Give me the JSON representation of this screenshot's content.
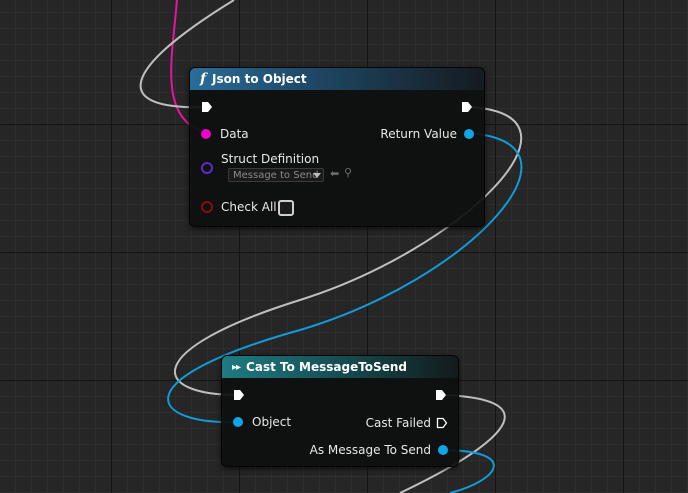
{
  "graph": {
    "nodes": {
      "json_to_object": {
        "title": "Json to Object",
        "icon": "function-icon",
        "inputs": {
          "data_label": "Data",
          "struct_definition_label": "Struct Definition",
          "struct_definition_value": "Message to Send",
          "check_all_label": "Check All"
        },
        "outputs": {
          "return_value_label": "Return Value"
        }
      },
      "cast_to_message": {
        "title": "Cast To MessageToSend",
        "icon": "cast-icon",
        "inputs": {
          "object_label": "Object"
        },
        "outputs": {
          "cast_failed_label": "Cast Failed",
          "as_message_label": "As Message To Send"
        }
      }
    }
  },
  "colors": {
    "exec": "#ffffff",
    "object_pin": "#0fa6e8",
    "string_pin": "#f000c8",
    "struct_pin": "#4a1e9e",
    "bool_pin": "#8a0d0d",
    "wire_exec": "#bfbfbf",
    "wire_object": "#119bd8",
    "wire_string": "#e6159e"
  }
}
